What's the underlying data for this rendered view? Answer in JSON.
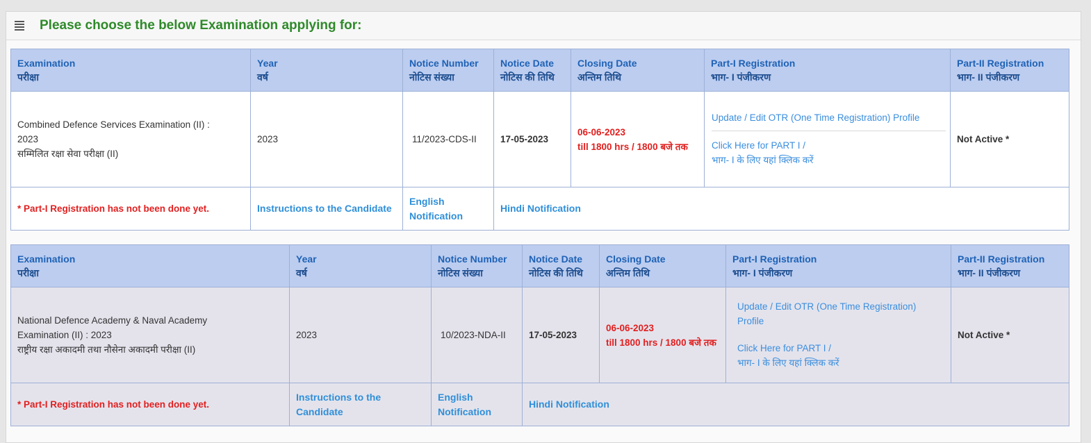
{
  "panel": {
    "title": "Please choose the below Examination applying for:"
  },
  "columns": {
    "examination": "Examination",
    "examination_hi": "परीक्षा",
    "year": "Year",
    "year_hi": "वर्ष",
    "notice_number": "Notice Number",
    "notice_number_hi": "नोटिस संख्या",
    "notice_date": "Notice Date",
    "notice_date_hi": "नोटिस की तिथि",
    "closing_date": "Closing Date",
    "closing_date_hi": "अन्तिम तिथि",
    "part1": "Part-I Registration",
    "part1_hi": "भाग- I पंजीकरण",
    "part2": "Part-II Registration",
    "part2_hi": "भाग- II पंजीकरण"
  },
  "exams": [
    {
      "name_line1": "Combined Defence Services Examination (II) :",
      "name_line2": "2023",
      "name_hi": "सम्मिलित रक्षा सेवा परीक्षा (II)",
      "year": "2023",
      "notice_number": "11/2023-CDS-II",
      "notice_date": "17-05-2023",
      "closing_date": "06-06-2023",
      "closing_time": "till 1800 hrs / 1800 बजे तक",
      "otr_link": "Update / Edit OTR (One Time Registration) Profile",
      "part1_link": "Click Here for PART I /",
      "part1_link_hi": "भाग- I के लिए यहां क्लिक करें",
      "part2_status": "Not Active *",
      "warning": "* Part-I Registration has not been done yet.",
      "instructions": "Instructions to the Candidate",
      "english_notification": "English Notification",
      "hindi_notification": "Hindi Notification"
    },
    {
      "name_line1": "National Defence Academy & Naval Academy",
      "name_line2": "Examination (II) : 2023",
      "name_hi": "राष्ट्रीय रक्षा अकादमी तथा नौसेना अकादमी परीक्षा (II)",
      "year": "2023",
      "notice_number": "10/2023-NDA-II",
      "notice_date": "17-05-2023",
      "closing_date": "06-06-2023",
      "closing_time": "till 1800 hrs / 1800 बजे तक",
      "otr_link": "Update / Edit OTR (One Time Registration) Profile",
      "part1_link": "Click Here for PART I /",
      "part1_link_hi": "भाग- I के लिए यहां क्लिक करें",
      "part2_status": "Not Active *",
      "warning": "* Part-I Registration has not been done yet.",
      "instructions": "Instructions to the Candidate",
      "english_notification": "English Notification",
      "hindi_notification": "Hindi Notification"
    }
  ],
  "icons": {
    "menu": "hamburger-menu-icon"
  },
  "colors": {
    "title_green": "#2f8a2a",
    "header_bg": "#bccdf0",
    "header_text": "#1f62b5",
    "alert_red": "#e11f1f",
    "date_green": "#22882a",
    "link_blue": "#2f8fd8"
  }
}
